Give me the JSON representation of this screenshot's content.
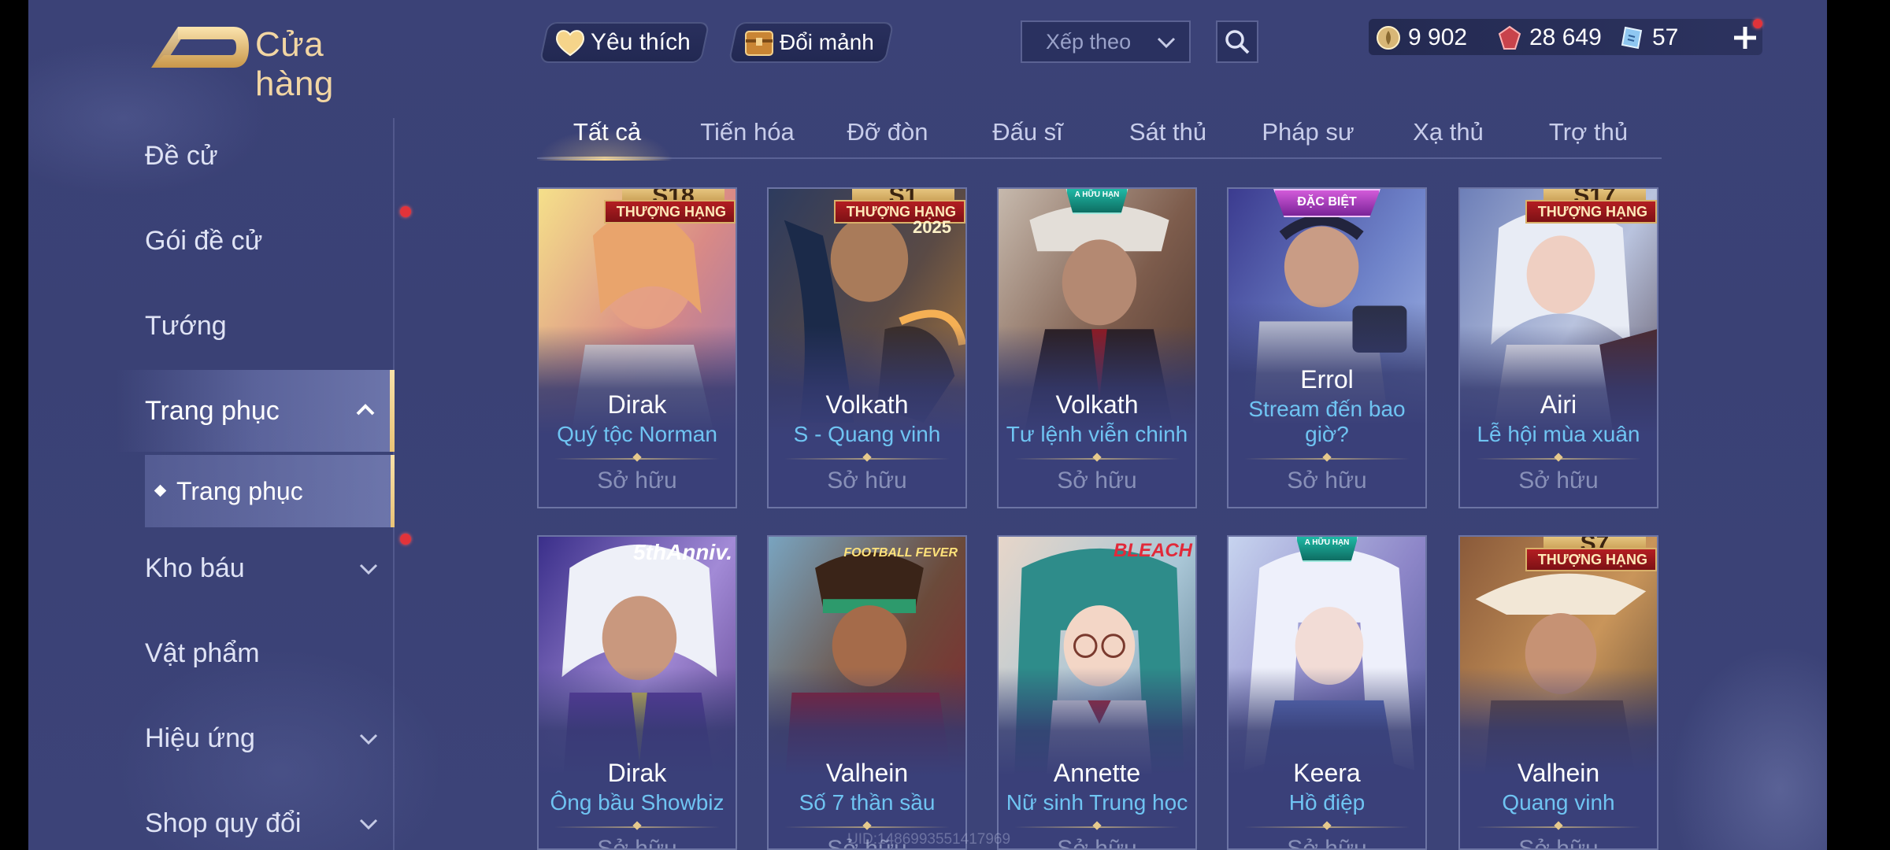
{
  "header": {
    "title": "Cửa hàng",
    "favorites_label": "Yêu thích",
    "exchange_label": "Đổi mảnh",
    "sort_placeholder": "Xếp theo"
  },
  "currencies": [
    {
      "icon": "gold-coin-icon",
      "value": "9 902"
    },
    {
      "icon": "ruby-gem-icon",
      "value": "28 649"
    },
    {
      "icon": "voucher-icon",
      "value": "57"
    }
  ],
  "sidebar": {
    "items": [
      {
        "label": "Đề cử"
      },
      {
        "label": "Gói đề cử"
      },
      {
        "label": "Tướng"
      },
      {
        "label": "Trang phục"
      },
      {
        "label": "Kho báu"
      },
      {
        "label": "Vật phẩm"
      },
      {
        "label": "Hiệu ứng"
      },
      {
        "label": "Shop quy đổi"
      }
    ],
    "sub_item": "Trang phục"
  },
  "tabs": [
    {
      "label": "Tất cả"
    },
    {
      "label": "Tiến hóa"
    },
    {
      "label": "Đỡ đòn"
    },
    {
      "label": "Đấu sĩ"
    },
    {
      "label": "Sát thủ"
    },
    {
      "label": "Pháp sư"
    },
    {
      "label": "Xạ thủ"
    },
    {
      "label": "Trợ thủ"
    }
  ],
  "cards": [
    {
      "hero": "Dirak",
      "skin": "Quý tộc Norman",
      "status": "Sở hữu",
      "badge": "THƯỢNG HẠNG",
      "badge_top": "S18"
    },
    {
      "hero": "Volkath",
      "skin": "S - Quang vinh",
      "status": "Sở hữu",
      "badge": "THƯỢNG HẠNG",
      "badge_top": "S1",
      "badge_year": "2025"
    },
    {
      "hero": "Volkath",
      "skin": "Tư lệnh viễn chinh",
      "status": "Sở hữu",
      "badge_teal": "A HỮU HẠN"
    },
    {
      "hero": "Errol",
      "skin": "Stream đến bao giờ?",
      "status": "Sở hữu",
      "badge_purple": "ĐẶC BIỆT"
    },
    {
      "hero": "Airi",
      "skin": "Lễ hội mùa xuân",
      "status": "Sở hữu",
      "badge": "THƯỢNG HẠNG",
      "badge_top": "S17"
    },
    {
      "hero": "Dirak",
      "skin": "Ông bầu Showbiz",
      "status": "Sở hữu",
      "badge_text": "5thAnniv."
    },
    {
      "hero": "Valhein",
      "skin": "Số 7 thần sầu",
      "status": "Sở hữu",
      "badge_text": "FOOTBALL FEVER"
    },
    {
      "hero": "Annette",
      "skin": "Nữ sinh Trung học",
      "status": "Sở hữu",
      "badge_text": "BLEACH"
    },
    {
      "hero": "Keera",
      "skin": "Hồ điệp",
      "status": "Sở hữu",
      "badge_teal": "A HỮU HẠN"
    },
    {
      "hero": "Valhein",
      "skin": "Quang vinh",
      "status": "Sở hữu",
      "badge": "THƯỢNG HẠNG",
      "badge_top": "S7"
    }
  ],
  "uid": "UID:1486993551417969",
  "colors": {
    "accent_gold": "#f2d6a3",
    "skin_name": "#6fc4f2",
    "notify_red": "#e2333a"
  }
}
